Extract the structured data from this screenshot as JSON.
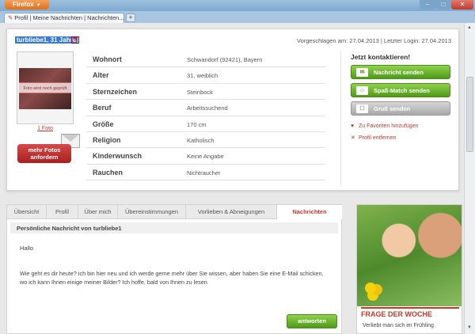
{
  "browser": {
    "app_button": "Firefox",
    "tab_title": "Profil | Meine Nachrichten | Nachrichten...",
    "new_tab_label": "+",
    "win_min": "–",
    "win_max": "□",
    "win_close": "✕"
  },
  "profile": {
    "username": "turbliebe1, 31 Jahre",
    "badge": "N",
    "proposed_info": "Vorgeschlagen am: 27.04.2013 | Letzter Login: 27.04.2013",
    "photo_overlay": "Foto wird noch geprüft",
    "photo_count": "1 Foto",
    "more_photos_button": "mehr Fotos anfordern",
    "attributes": [
      {
        "label": "Wohnort",
        "value": "Schwandorf (92421), Bayern"
      },
      {
        "label": "Alter",
        "value": "31, weiblich"
      },
      {
        "label": "Sternzeichen",
        "value": "Steinbock"
      },
      {
        "label": "Beruf",
        "value": "Arbeitssuchend"
      },
      {
        "label": "Größe",
        "value": "170 cm"
      },
      {
        "label": "Religion",
        "value": "Katholisch"
      },
      {
        "label": "Kinderwunsch",
        "value": "Keine Angabe"
      },
      {
        "label": "Rauchen",
        "value": "Nichtraucher"
      }
    ]
  },
  "contact": {
    "title": "Jetzt kontaktieren!",
    "send_message": "Nachricht senden",
    "fun_match": "Spaß-Match senden",
    "send_greeting": "Gruß senden",
    "add_favorite": "Zu Favoriten hinzufügen",
    "remove_profile": "Profil entfernen"
  },
  "tabs": [
    {
      "label": "Übersicht"
    },
    {
      "label": "Profil"
    },
    {
      "label": "Über mich"
    },
    {
      "label": "Übereinstimmungen"
    },
    {
      "label": "Vorlieben & Abneigungen"
    },
    {
      "label": "Nachrichten"
    }
  ],
  "message": {
    "header": "Persönliche Nachricht von turbliebe1",
    "greeting": "Hallo",
    "body": "Wie geht es dir heute? ich bin hier neu und ich werde gerne mehr über Sie wissen, aber haben Sie eine E-Mail schicken, wo ich kann Ihnen einige meiner Bilder? Ich hoffe, bald von Ihnen zu lesen",
    "reply_button": "antworten"
  },
  "ad": {
    "title": "FRAGE DER WOCHE",
    "text": "Verliebt man sich im Frühling"
  },
  "colors": {
    "accent_red": "#c0392b",
    "button_green": "#4f9a19",
    "username_highlight": "#3a7bd5"
  }
}
